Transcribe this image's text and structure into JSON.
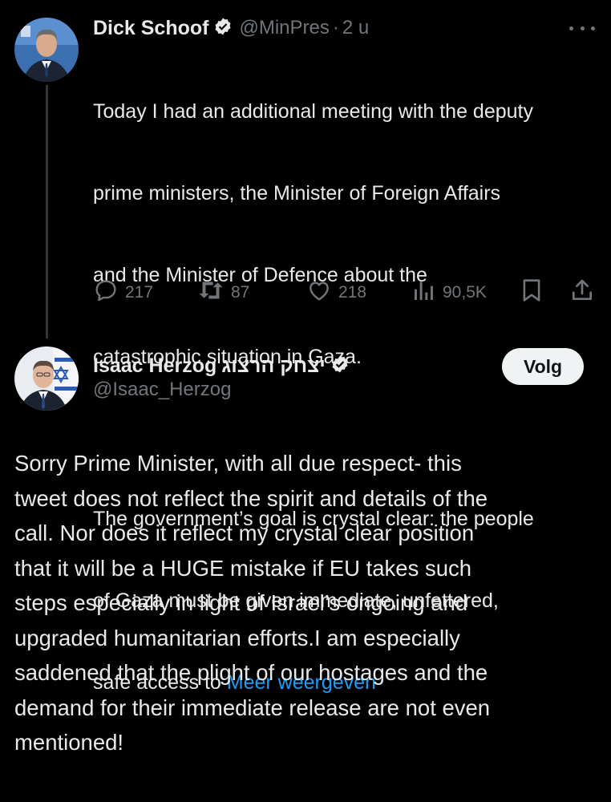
{
  "tweet1": {
    "author_name": "Dick Schoof",
    "handle": "@MinPres",
    "separator": "·",
    "time": "2 u",
    "text_lines": [
      "Today I had an additional meeting with the deputy",
      "prime ministers, the Minister of Foreign Affairs",
      "and the Minister of Defence about the",
      "catastrophic situation in Gaza."
    ],
    "text_lines_2": [
      "The government’s goal is crystal clear: the people",
      "of Gaza must be given immediate, unfettered,"
    ],
    "last_line_prefix": "safe access to ",
    "show_more": "Meer weergeven",
    "replies": "217",
    "reposts": "87",
    "likes": "218",
    "views": "90,5K"
  },
  "tweet2": {
    "author_name": "Isaac Herzog",
    "author_name_hebrew": "יצחק הרצוג",
    "handle": "@Isaac_Herzog",
    "follow_label": "Volg",
    "text_lines": [
      "Sorry Prime Minister, with all due respect- this",
      "tweet does not reflect the spirit and details of the",
      "call. Nor does it reflect my crystal clear position",
      "that it will be a HUGE mistake if EU takes such",
      "steps especially in light of Israel’s ongoing and",
      "upgraded humanitarian efforts.I am especially",
      "saddened that the plight of our hostages and the",
      "demand for their immediate release are not even",
      "mentioned!"
    ]
  },
  "colors": {
    "background": "#000000",
    "text": "#e7e9ea",
    "muted": "#71767b",
    "link": "#1d9bf0",
    "follow_bg": "#eff3f4"
  },
  "icons": [
    "avatar-photo",
    "verified-badge-icon",
    "more-icon",
    "reply-icon",
    "repost-icon",
    "like-icon",
    "views-icon",
    "bookmark-icon",
    "share-icon"
  ]
}
